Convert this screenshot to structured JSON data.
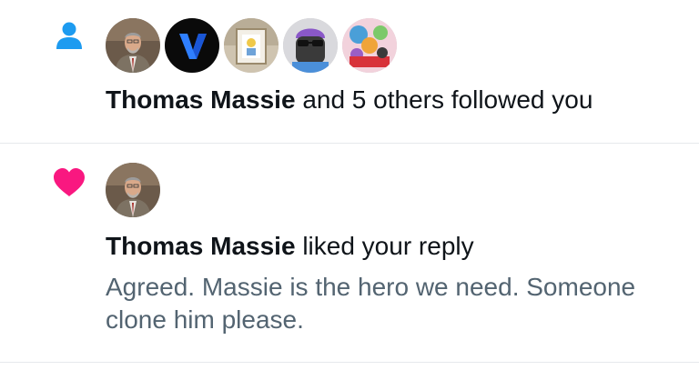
{
  "colors": {
    "follow_icon": "#1d9bf0",
    "like_icon": "#f91880",
    "secondary_text": "#536471",
    "divider": "#e6e9ec"
  },
  "notifications": [
    {
      "type": "follow",
      "icon": "person-icon",
      "avatars": [
        "thomas-massie-avatar",
        "blue-v-logo-avatar",
        "framed-art-avatar",
        "sunglasses-character-avatar",
        "colorful-art-avatar"
      ],
      "actor": "Thomas Massie",
      "action": "and 5 others followed you"
    },
    {
      "type": "like",
      "icon": "heart-icon",
      "avatars": [
        "thomas-massie-avatar"
      ],
      "actor": "Thomas Massie",
      "action": "liked your reply",
      "snippet": "Agreed. Massie is the hero we need. Someone clone him please."
    }
  ]
}
